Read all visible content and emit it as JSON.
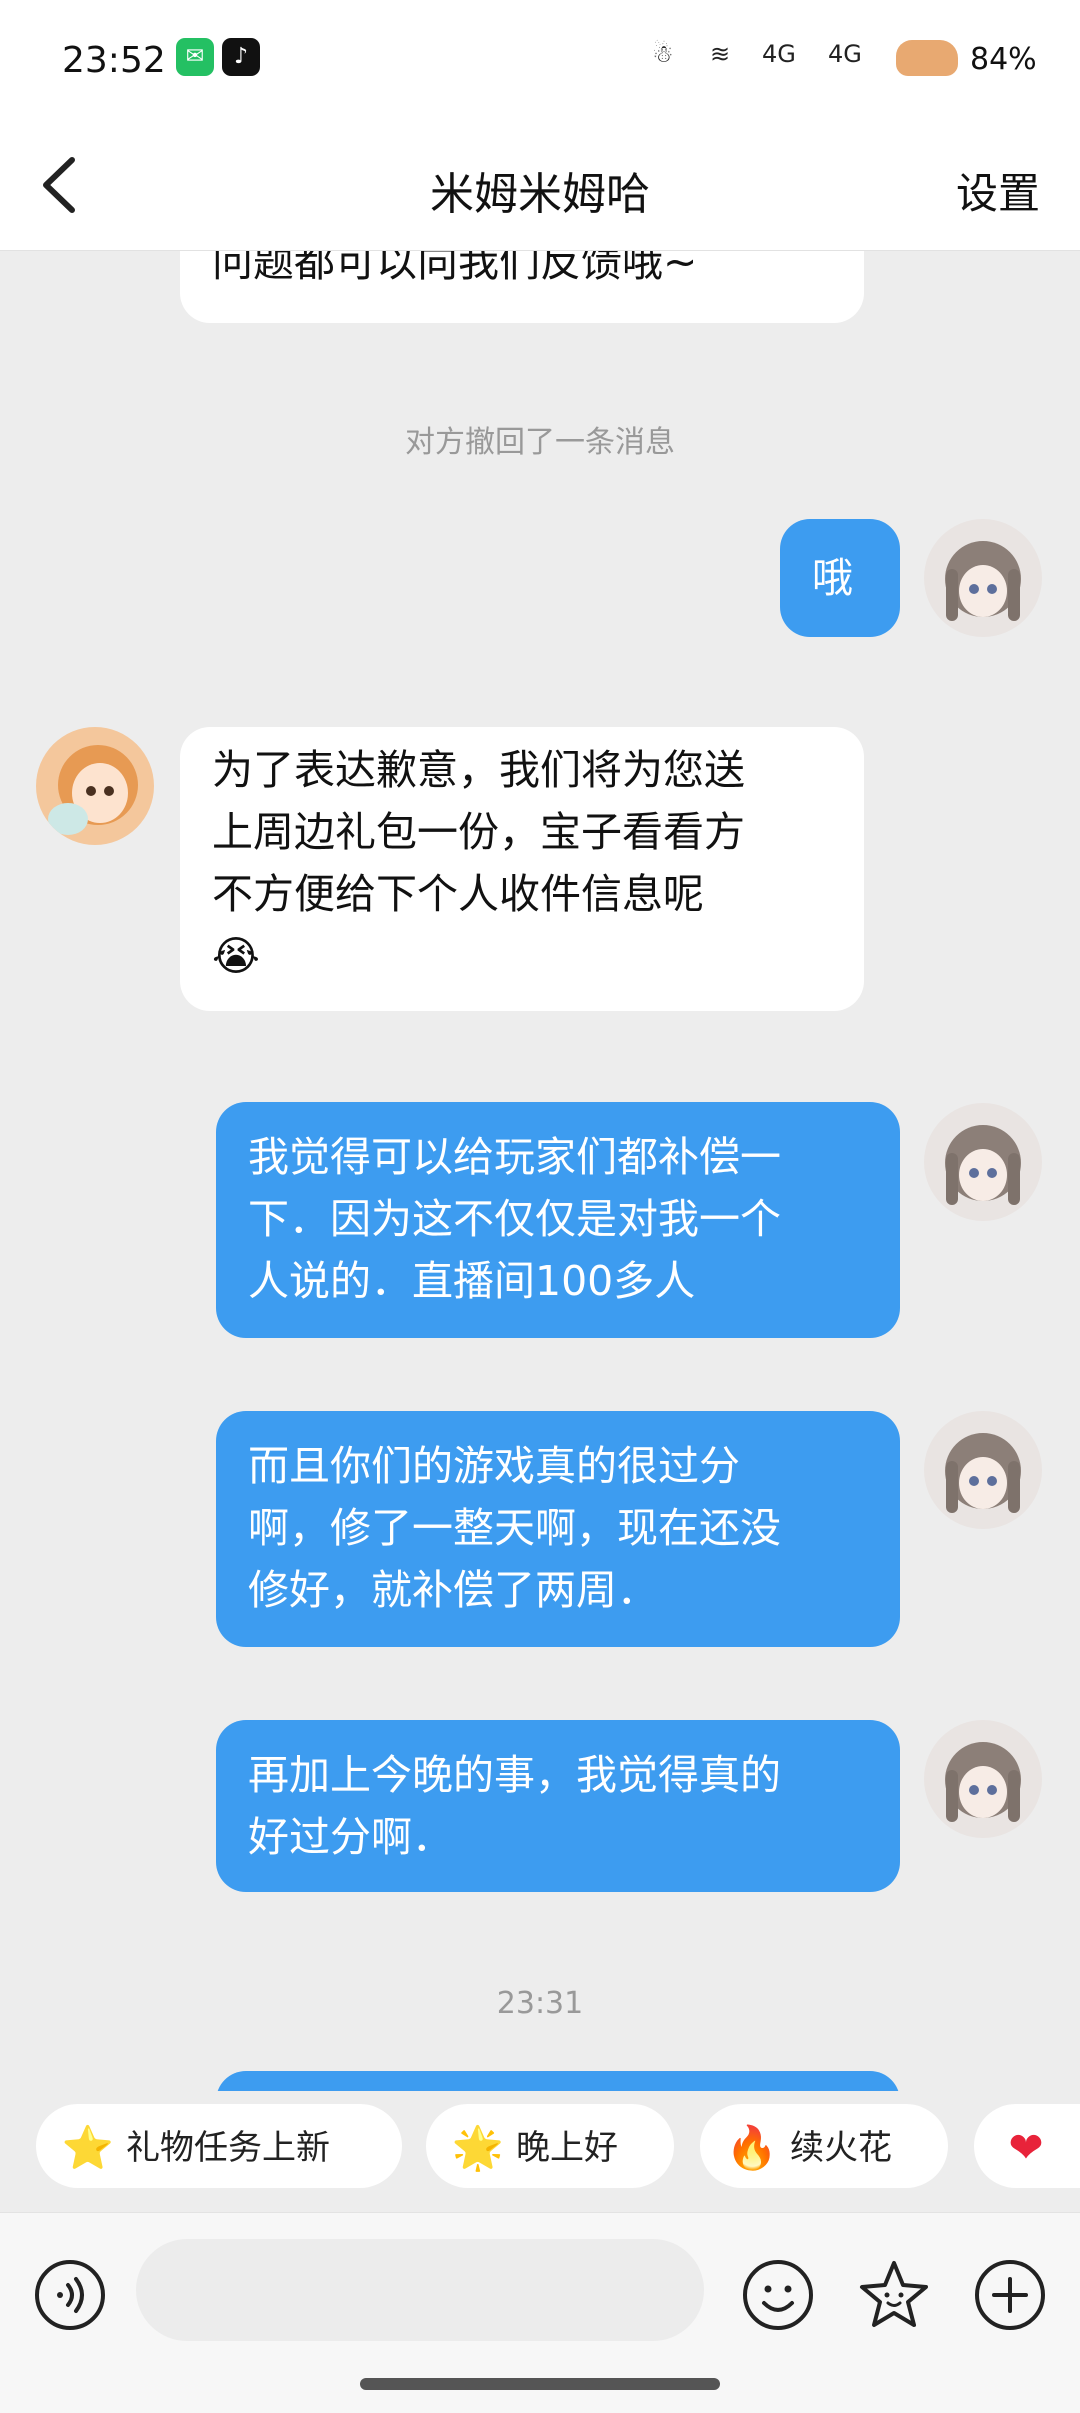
{
  "status_bar": {
    "time": "23:52",
    "apps": [
      "wechat-icon",
      "tiktok-icon"
    ],
    "network_1": "4G",
    "network_2": "4G",
    "battery": "84%"
  },
  "header": {
    "back_icon": "chevron-left-icon",
    "title": "米姆米姆哈",
    "settings_label": "设置"
  },
  "chat": {
    "partial_top_message": "问题都可以向我们反馈哦~",
    "recall_notice": "对方撤回了一条消息",
    "messages": [
      {
        "side": "out",
        "lines": [
          "哦"
        ]
      },
      {
        "side": "in",
        "lines": [
          "为了表达歉意，我们将为您送",
          "上周边礼包一份，宝子看看方",
          "不方便给下个人收件信息呢"
        ],
        "emoji": "😭"
      },
      {
        "side": "out",
        "lines": [
          "我觉得可以给玩家们都补偿一",
          "下．因为这不仅仅是对我一个",
          "人说的．直播间100多人"
        ]
      },
      {
        "side": "out",
        "lines": [
          "而且你们的游戏真的很过分",
          "啊，修了一整天啊，现在还没",
          "修好，就补偿了两周．"
        ]
      },
      {
        "side": "out",
        "lines": [
          "再加上今晚的事，我觉得真的",
          "好过分啊．"
        ]
      }
    ],
    "timestamp": "23:31"
  },
  "quick_replies": [
    {
      "icon": "star-icon",
      "glyph": "⭐",
      "label": "礼物任务上新"
    },
    {
      "icon": "star-face-icon",
      "glyph": "🌟",
      "label": "晚上好"
    },
    {
      "icon": "fire-icon",
      "glyph": "🔥",
      "label": "续火花"
    },
    {
      "icon": "heart-icon",
      "glyph": "❤",
      "label": ""
    }
  ],
  "input_bar": {
    "voice_icon": "voice-icon",
    "placeholder": "",
    "emoji_icon": "emoji-icon",
    "sticker_icon": "star-sticker-icon",
    "add_icon": "plus-icon"
  },
  "colors": {
    "outgoing_bubble": "#3d9cf0",
    "incoming_bubble": "#ffffff",
    "background": "#ededed"
  }
}
